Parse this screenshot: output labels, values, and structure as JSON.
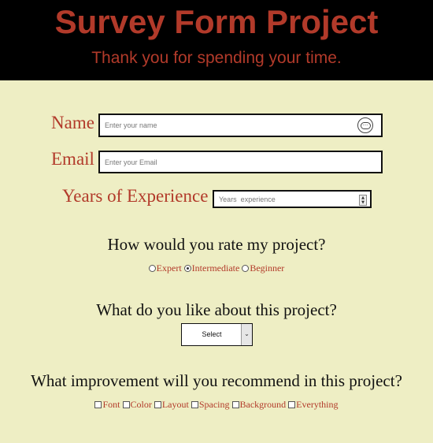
{
  "header": {
    "title": "Survey Form Project",
    "subtitle": "Thank you for spending your time."
  },
  "form": {
    "name": {
      "label": "Name",
      "placeholder": "Enter your name"
    },
    "email": {
      "label": "Email",
      "placeholder": "Enter your Email"
    },
    "experience": {
      "label": "Years of Experience",
      "placeholder": "Years  experience"
    }
  },
  "rating": {
    "question": "How would you rate my project?",
    "options": [
      {
        "label": "Expert",
        "checked": false
      },
      {
        "label": "Intermediate",
        "checked": true
      },
      {
        "label": "Beginner",
        "checked": false
      }
    ]
  },
  "likes": {
    "question": "What do you like about this project?",
    "selected": "Select"
  },
  "improvements": {
    "question": "What improvement will you recommend in this project?",
    "options": [
      {
        "label": "Font"
      },
      {
        "label": "Color"
      },
      {
        "label": "Layout"
      },
      {
        "label": "Spacing"
      },
      {
        "label": "Background"
      },
      {
        "label": "Everything"
      }
    ]
  },
  "icons": {
    "password_manager": "password-manager-icon",
    "spinner": "number-spinner-icon",
    "dropdown": "chevron-down-icon"
  },
  "colors": {
    "background": "#eeeec4",
    "header_bg": "#000000",
    "accent": "#b23a2a"
  }
}
